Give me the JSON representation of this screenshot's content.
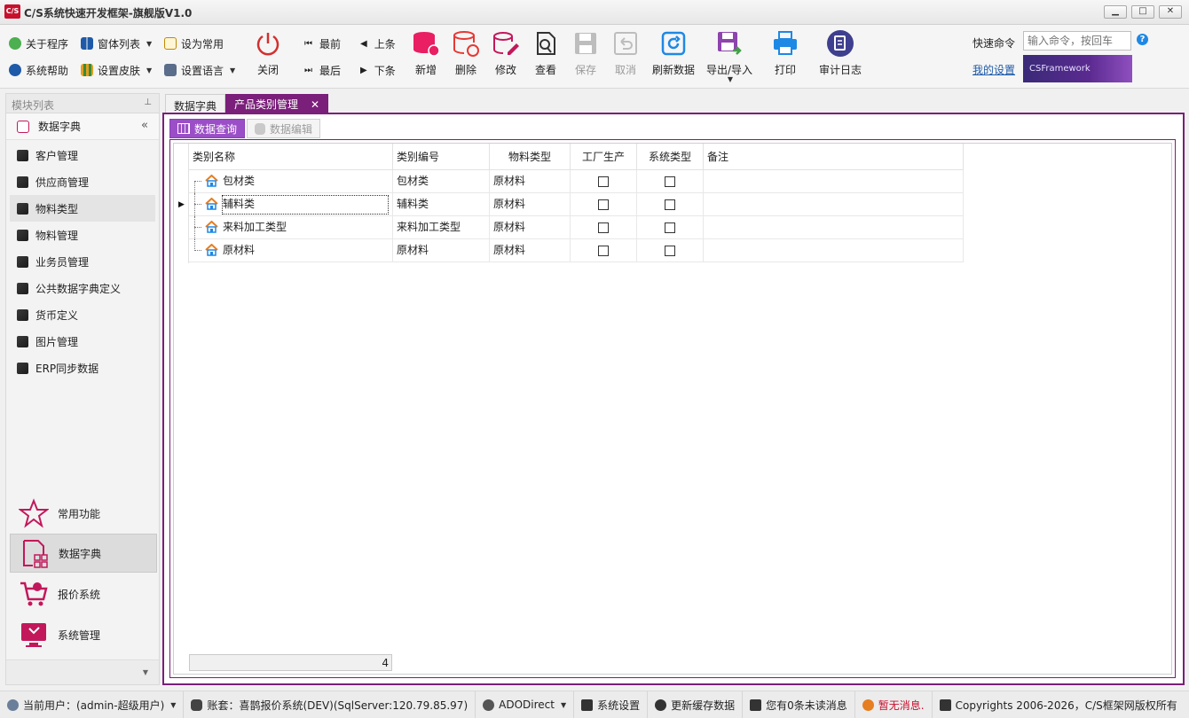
{
  "window": {
    "logo_text": "C/S",
    "title": "C/S系统快速开发框架-旗舰版V1.0",
    "min_label": "▁",
    "max_label": "□",
    "close_label": "✕"
  },
  "toolbar": {
    "about": "关于程序",
    "window_list": "窗体列表",
    "set_common": "设为常用",
    "system_help": "系统帮助",
    "set_skin": "设置皮肤",
    "set_language": "设置语言",
    "close": "关闭",
    "first": "最前",
    "last": "最后",
    "prev": "上条",
    "next": "下条",
    "add": "新增",
    "delete": "删除",
    "edit": "修改",
    "view": "查看",
    "save": "保存",
    "cancel": "取消",
    "refresh": "刷新数据",
    "export_import": "导出/导入",
    "print": "打印",
    "audit_log": "审计日志",
    "quick_command_label": "快速命令",
    "quick_command_placeholder": "输入命令，按回车",
    "help_icon": "?",
    "my_settings": "我的设置",
    "banner_text": "CSFramework"
  },
  "sidebar": {
    "header": "模块列表",
    "pin": "⊥",
    "group_title": "数据字典",
    "collapse": "«",
    "items": [
      "客户管理",
      "供应商管理",
      "物料类型",
      "物料管理",
      "业务员管理",
      "公共数据字典定义",
      "货币定义",
      "图片管理",
      "ERP同步数据"
    ],
    "selected_item": "物料类型",
    "bottom": [
      "常用功能",
      "数据字典",
      "报价系统",
      "系统管理"
    ],
    "selected_bottom": "数据字典",
    "more": "▼"
  },
  "doc_tabs": [
    "数据字典",
    "产品类别管理"
  ],
  "active_doc_tab": "产品类别管理",
  "tab_close": "✕",
  "sub_tabs": [
    "数据查询",
    "数据编辑"
  ],
  "grid": {
    "columns": [
      "类别名称",
      "类别编号",
      "物料类型",
      "工厂生产",
      "系统类型",
      "备注"
    ],
    "rows": [
      {
        "name": "包材类",
        "code": "包材类",
        "material_type": "原材料",
        "factory": false,
        "system": false,
        "remark": ""
      },
      {
        "name": "辅料类",
        "code": "辅料类",
        "material_type": "原材料",
        "factory": false,
        "system": false,
        "remark": ""
      },
      {
        "name": "来料加工类型",
        "code": "来料加工类型",
        "material_type": "原材料",
        "factory": false,
        "system": false,
        "remark": ""
      },
      {
        "name": "原材料",
        "code": "原材料",
        "material_type": "原材料",
        "factory": false,
        "system": false,
        "remark": ""
      }
    ],
    "focused_row": 1,
    "pointer": "▶",
    "footer_count": "4"
  },
  "statusbar": {
    "user": "当前用户：(admin-超级用户)",
    "account": "账套：喜鹊报价系统(DEV)(SqlServer:120.79.85.97)",
    "connection": "ADODirect",
    "settings": "系统设置",
    "update_cache": "更新缓存数据",
    "unread": "您有0条未读消息",
    "no_message": "暂无消息.",
    "copyright": "Copyrights 2006-2026，C/S框架网版权所有"
  }
}
